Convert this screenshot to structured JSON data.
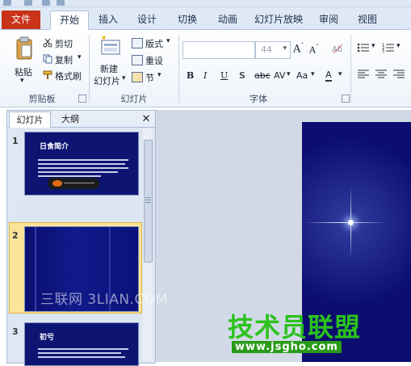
{
  "ribbon_tabs": {
    "file": "文件",
    "home": "开始",
    "insert": "插入",
    "design": "设计",
    "transitions": "切换",
    "animations": "动画",
    "slideshow": "幻灯片放映",
    "review": "审阅",
    "view": "视图"
  },
  "clipboard": {
    "paste": "粘贴",
    "cut": "剪切",
    "copy": "复制",
    "format_painter": "格式刷",
    "label": "剪贴板"
  },
  "slides_group": {
    "new_slide_line1": "新建",
    "new_slide_line2": "幻灯片",
    "layout": "版式",
    "reset": "重设",
    "section": "节",
    "label": "幻灯片"
  },
  "font": {
    "size": "44",
    "label": "字体",
    "bold": "B",
    "italic": "I",
    "underline": "U",
    "shadow": "S",
    "strike": "abc",
    "spacing": "AV",
    "case": "Aa",
    "color": "A"
  },
  "pane": {
    "tab_slides": "幻灯片",
    "tab_outline": "大纲",
    "close": "✕"
  },
  "slides": [
    {
      "number": "1",
      "title": "日食简介"
    },
    {
      "number": "2",
      "title": ""
    },
    {
      "number": "3",
      "title": "初亏"
    }
  ],
  "watermarks": {
    "site1": "三联网 3LIAN.COM",
    "site2": "技术员联盟",
    "site2_url": "www.jsgho.com"
  },
  "colors": {
    "file_tab": "#c8331a",
    "slide_bg": "#0b0e6e",
    "watermark_green": "#2bc21c"
  }
}
